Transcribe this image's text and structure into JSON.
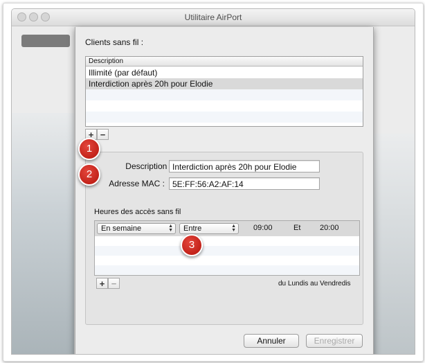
{
  "window": {
    "title": "Utilitaire AirPort"
  },
  "sheet": {
    "clients_label": "Clients sans fil :",
    "table_header": "Description",
    "clients": [
      {
        "label": "Illimité  (par défaut)"
      },
      {
        "label": "Interdiction après 20h pour Elodie"
      }
    ],
    "add_label": "+",
    "remove_label": "−",
    "description_label": "Description :",
    "description_value": "Interdiction après 20h pour Elodie",
    "mac_label": "Adresse MAC :",
    "mac_value": "5E:FF:56:A2:AF:14",
    "hours_label": "Heures des accès sans fil",
    "schedule": {
      "days": "En semaine",
      "mode": "Entre",
      "start": "09:00",
      "joiner": "Et",
      "end": "20:00"
    },
    "days_text": "du Lundis au Vendredis",
    "cancel_label": "Annuler",
    "save_label": "Enregistrer"
  },
  "annotations": {
    "one": "1",
    "two": "2",
    "three": "3"
  },
  "colors": {
    "badge": "#c81e14",
    "selection": "#d9d9d9"
  }
}
